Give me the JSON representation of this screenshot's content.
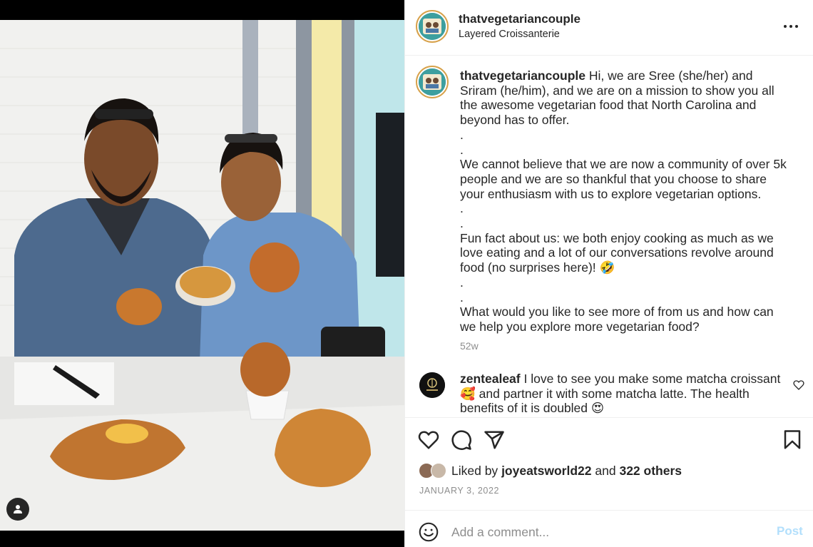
{
  "post": {
    "username": "thatvegetariancouple",
    "location": "Layered Croissanterie"
  },
  "caption": {
    "username": "thatvegetariancouple",
    "text": "Hi, we are Sree (she/her) and Sriram (he/him), and we are on a mission to show you all the awesome vegetarian food that North Carolina and beyond has to offer.\n.\n.\nWe cannot believe that we are now a community of over 5k people and we are so thankful that you choose to share your enthusiasm with us to explore vegetarian options.\n.\n.\nFun fact about us: we both enjoy cooking as much as we love eating and a lot of our conversations revolve around food (no surprises here)! 🤣\n.\n.\nWhat would you like to see more of from us and how can we help you explore more vegetarian food?",
    "time": "52w"
  },
  "comment": {
    "username": "zentealeaf",
    "text": "I love to see you make some matcha croissant 🥰 and partner it with some matcha latte. The health benefits of it is doubled 😍"
  },
  "actions": {
    "icons": [
      "heart-icon",
      "comment-icon",
      "share-icon",
      "bookmark-icon"
    ]
  },
  "likes": {
    "prefix": "Liked by",
    "user": "joyeatsworld22",
    "and": "and",
    "others": "322 others"
  },
  "date": "JANUARY 3, 2022",
  "composer": {
    "placeholder": "Add a comment...",
    "post_label": "Post"
  },
  "colors": {
    "text": "#262626",
    "secondary": "#8e8e8e",
    "post_disabled": "#b2dffc",
    "story_ring": "#d7a14a"
  }
}
